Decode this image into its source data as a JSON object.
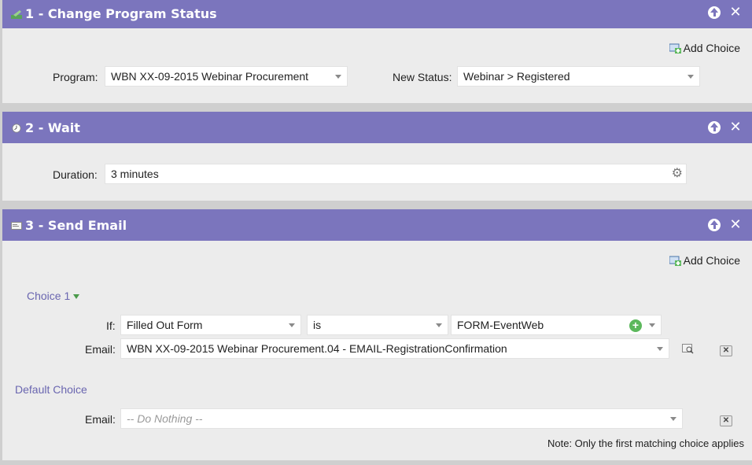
{
  "steps": [
    {
      "number_title": "1 - Change Program Status",
      "icon": "edit-pencil-icon",
      "add_choice_label": "Add Choice",
      "program_label": "Program:",
      "program_value": "WBN XX-09-2015 Webinar Procurement",
      "new_status_label": "New Status:",
      "new_status_value": "Webinar > Registered"
    },
    {
      "number_title": "2 - Wait",
      "icon": "clock-icon",
      "duration_label": "Duration:",
      "duration_value": "3 minutes"
    },
    {
      "number_title": "3 - Send Email",
      "icon": "email-icon",
      "add_choice_label": "Add Choice",
      "choice_label": "Choice 1",
      "if_label": "If:",
      "if_field": "Filled Out Form",
      "if_operator": "is",
      "if_value": "FORM-EventWeb",
      "email_label": "Email:",
      "email_value": "WBN XX-09-2015 Webinar Procurement.04 - EMAIL-RegistrationConfirmation",
      "default_choice_label": "Default Choice",
      "default_email_label": "Email:",
      "default_email_value": "-- Do Nothing --",
      "note": "Note: Only the first matching choice applies"
    }
  ],
  "colors": {
    "header_bg": "#7b75bd",
    "panel_bg": "#ececec",
    "choice_text": "#6a66b0"
  }
}
